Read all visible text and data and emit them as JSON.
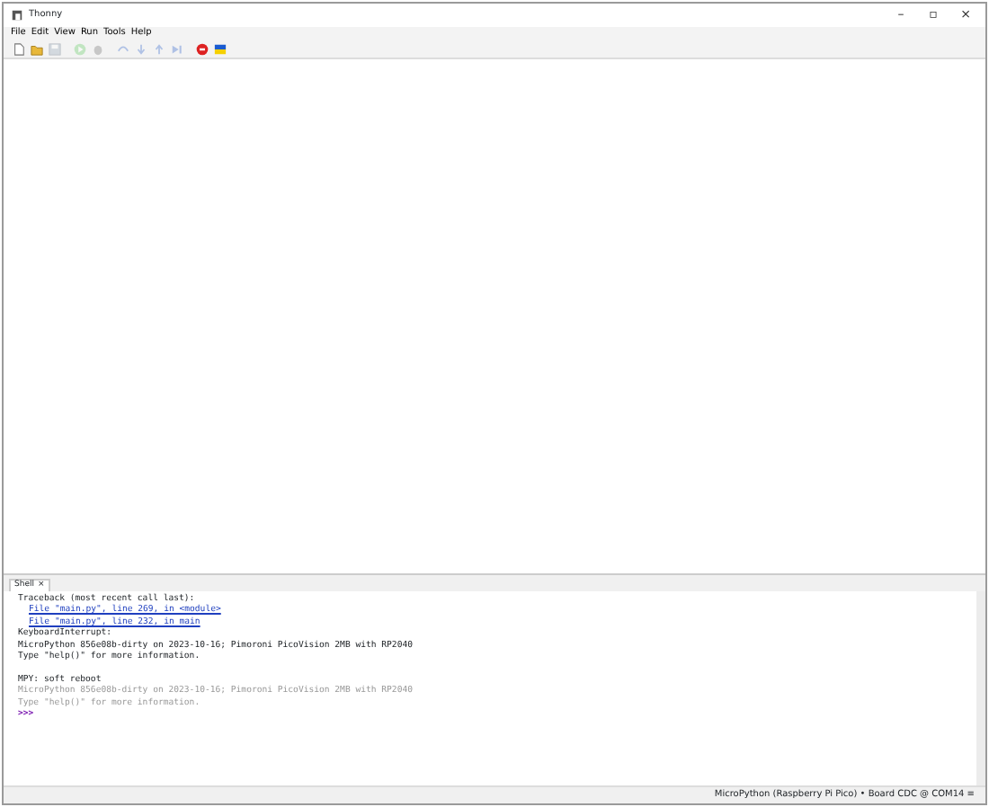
{
  "window": {
    "title": "Thonny",
    "controls": [
      "–",
      "▫",
      "×"
    ]
  },
  "menu": [
    "File",
    "Edit",
    "View",
    "Run",
    "Tools",
    "Help"
  ],
  "toolbar": [
    {
      "kind": "new",
      "disabled": false
    },
    {
      "kind": "open",
      "disabled": false
    },
    {
      "kind": "save",
      "disabled": true
    },
    {
      "kind": "run",
      "disabled": true
    },
    {
      "kind": "debug",
      "disabled": true
    },
    {
      "kind": "step-over",
      "disabled": true
    },
    {
      "kind": "step-into",
      "disabled": true
    },
    {
      "kind": "step-out",
      "disabled": true
    },
    {
      "kind": "resume",
      "disabled": true
    },
    {
      "kind": "stop",
      "disabled": false
    },
    {
      "kind": "flag",
      "disabled": false
    }
  ],
  "shell": {
    "tab": "Shell",
    "close": "×",
    "lines": [
      {
        "kind": "text",
        "text": "Traceback (most recent call last):"
      },
      {
        "kind": "link",
        "text": "File \"main.py\", line 269, in <module>"
      },
      {
        "kind": "link",
        "text": "File \"main.py\", line 232, in main"
      },
      {
        "kind": "text",
        "text": "KeyboardInterrupt:"
      },
      {
        "kind": "text",
        "text": "MicroPython 856e08b-dirty on 2023-10-16; Pimoroni PicoVision 2MB with RP2040"
      },
      {
        "kind": "text",
        "text": "Type \"help()\" for more information."
      },
      {
        "kind": "reboot",
        "text": "MPY: soft reboot"
      },
      {
        "kind": "dim",
        "text": "MicroPython 856e08b-dirty on 2023-10-16; Pimoroni PicoVision 2MB with RP2040"
      },
      {
        "kind": "dim",
        "text": "Type \"help()\" for more information."
      },
      {
        "kind": "prompt",
        "text": ">>>"
      }
    ]
  },
  "status_bar": {
    "interpreter": "MicroPython (Raspberry Pi Pico) • Board CDC @ COM14 ≡"
  }
}
